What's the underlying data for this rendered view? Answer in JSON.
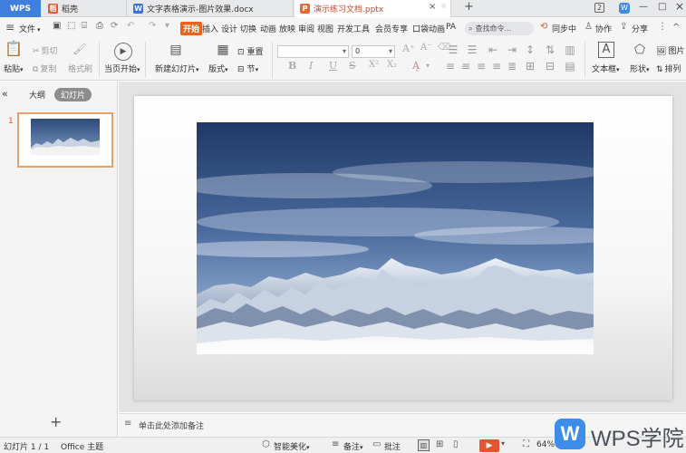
{
  "tabs": {
    "wps": "WPS",
    "daoke": "稻壳",
    "docx": "文字表格演示-图片效果.docx",
    "pptx": "演示练习文档.pptx",
    "close_glyph": "×",
    "new_tab_glyph": "+"
  },
  "window": {
    "count_badge": "2",
    "minimize": "—",
    "maximize": "□",
    "close": "×"
  },
  "menu": {
    "hamburger": "≡",
    "file": "文件",
    "file_caret": "▾",
    "items": [
      "开始",
      "插入",
      "设计",
      "切换",
      "动画",
      "放映",
      "审阅",
      "视图",
      "开发工具",
      "会员专享",
      "口袋动画",
      "PA"
    ],
    "search_placeholder": "查找命令...",
    "sync": "同步中",
    "collab": "协作",
    "share": "分享",
    "more": "⋮",
    "collapse": "^"
  },
  "ribbon": {
    "paste": "粘贴",
    "paste_caret": "▾",
    "cut": "剪切",
    "copy": "复制",
    "format_painter": "格式刷",
    "play_from_current": "当页开始",
    "play_caret": "▾",
    "new_slide": "新建幻灯片",
    "new_slide_caret": "▾",
    "layout": "版式",
    "layout_caret": "▾",
    "reset": "重置",
    "section": "节",
    "section_caret": "▾",
    "font_name": "",
    "font_size": "0",
    "bold": "B",
    "italic": "I",
    "underline": "U",
    "strike": "S",
    "textbox": "文本框",
    "textbox_caret": "▾",
    "shape": "形状",
    "shape_caret": "▾",
    "picture": "图片",
    "picture_caret": "▾",
    "arrange": "排列",
    "arrange_caret": "▾"
  },
  "left_panel": {
    "collapse_glyph": "«",
    "outline_tab": "大纲",
    "slides_tab": "幻灯片",
    "slide_number": "1",
    "add_slide": "+"
  },
  "notes": {
    "placeholder": "单击此处添加备注"
  },
  "status": {
    "slide_count": "幻灯片 1 / 1",
    "theme": "Office 主题",
    "beautify": "智能美化",
    "beautify_caret": "▾",
    "notes": "备注",
    "notes_caret": "▾",
    "comments": "批注",
    "zoom": "64%",
    "zoom_minus": "—"
  },
  "watermark": {
    "logo": "W",
    "text": "WPS学院"
  },
  "colors": {
    "accent": "#e8641b",
    "wps_blue": "#3f7fe0",
    "selection": "#e8a06b"
  }
}
